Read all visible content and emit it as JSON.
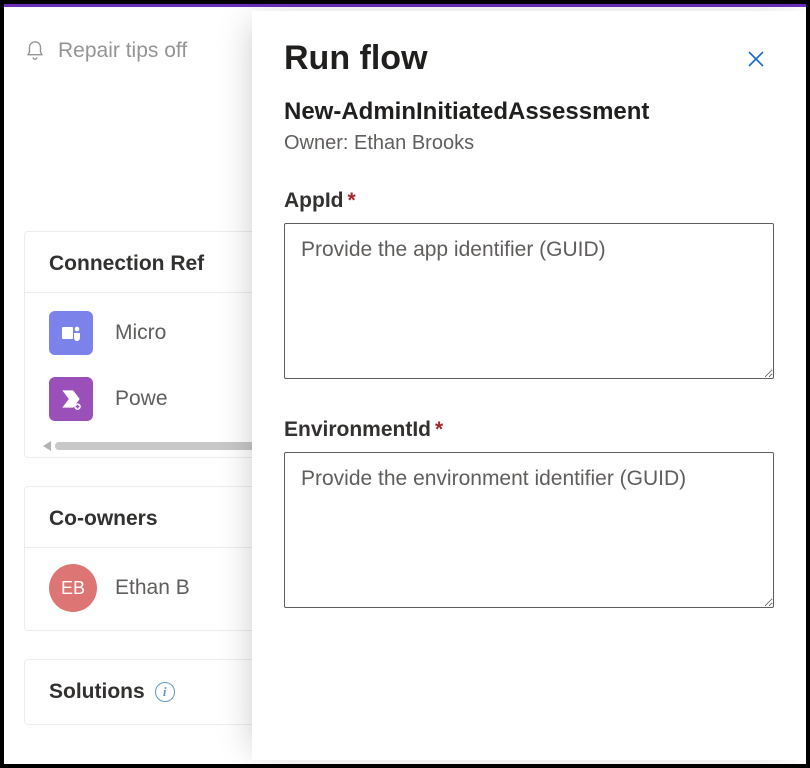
{
  "toolbar": {
    "repair_tips": "Repair tips off"
  },
  "background": {
    "connection_card_title": "Connection Ref",
    "connections": [
      {
        "label": "Micro",
        "icon": "teams"
      },
      {
        "label": "Powe",
        "icon": "power"
      }
    ],
    "coowners_title": "Co-owners",
    "owner": {
      "initials": "EB",
      "name": "Ethan B"
    },
    "solutions_title": "Solutions"
  },
  "panel": {
    "title": "Run flow",
    "flow_name": "New-AdminInitiatedAssessment",
    "owner_line": "Owner: Ethan Brooks",
    "fields": {
      "appid": {
        "label": "AppId",
        "placeholder": "Provide the app identifier (GUID)",
        "value": ""
      },
      "envid": {
        "label": "EnvironmentId",
        "placeholder": "Provide the environment identifier (GUID)",
        "value": ""
      }
    }
  }
}
